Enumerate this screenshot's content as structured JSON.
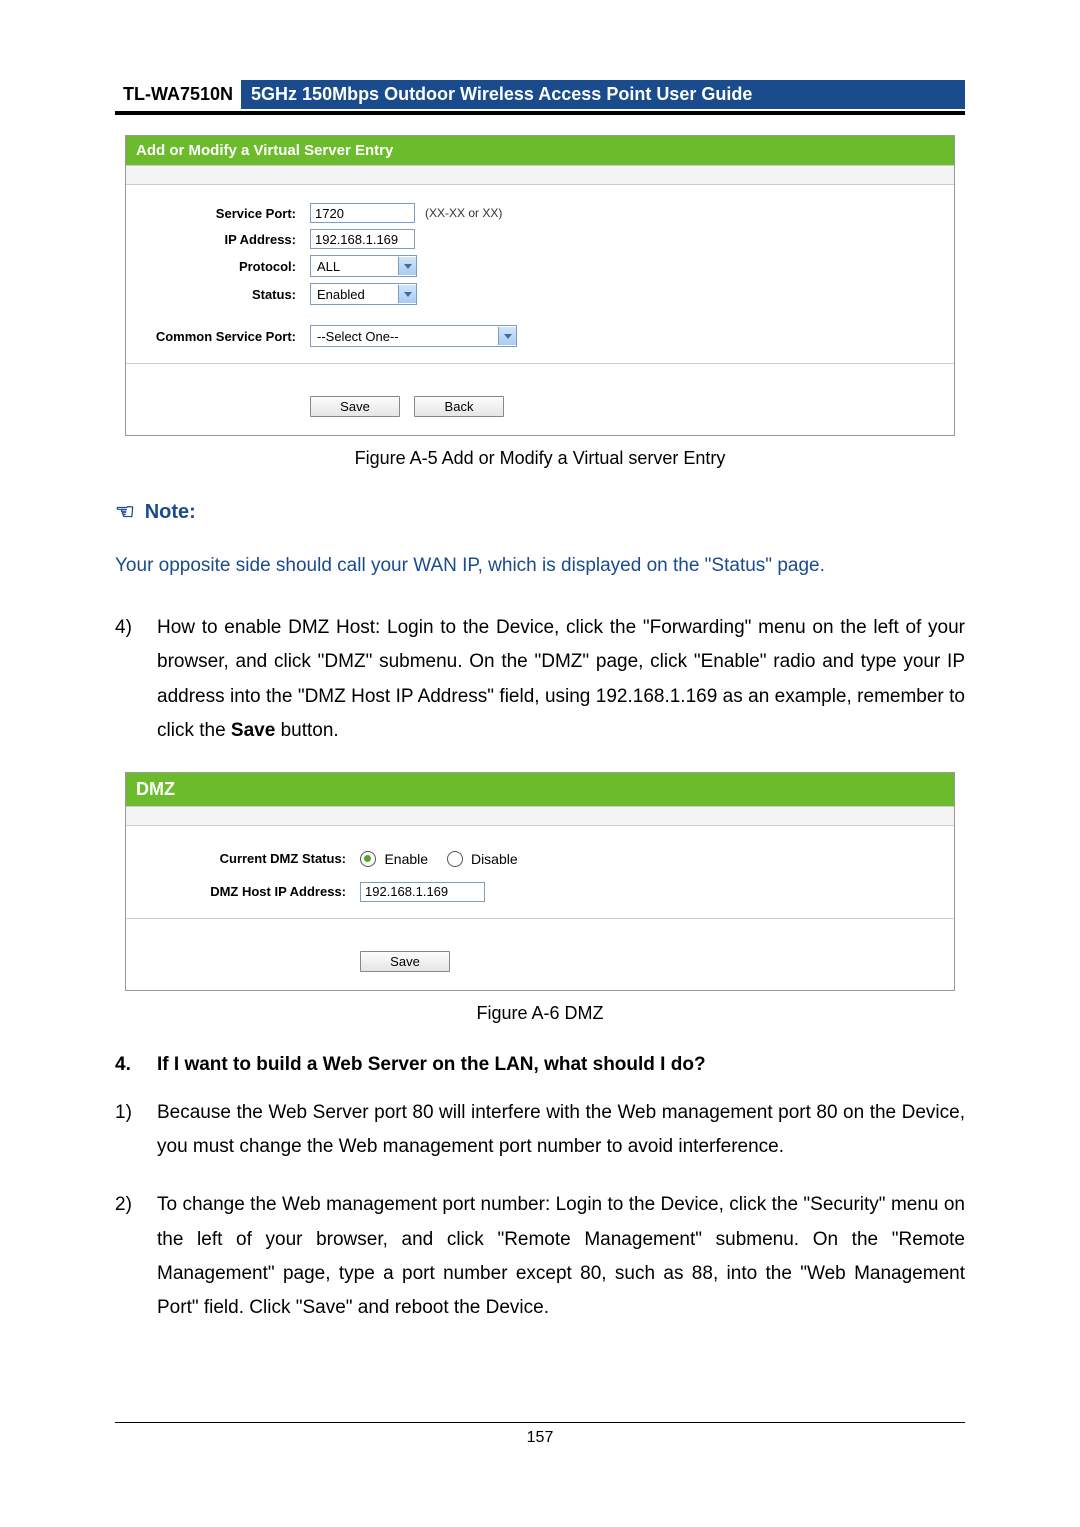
{
  "header": {
    "model": "TL-WA7510N",
    "title": "5GHz 150Mbps Outdoor Wireless Access Point User Guide"
  },
  "panel1": {
    "title": "Add or Modify a Virtual Server Entry",
    "rows": {
      "service_port_label": "Service Port:",
      "service_port_value": "1720",
      "service_port_hint": "(XX-XX or XX)",
      "ip_label": "IP Address:",
      "ip_value": "192.168.1.169",
      "protocol_label": "Protocol:",
      "protocol_value": "ALL",
      "status_label": "Status:",
      "status_value": "Enabled",
      "common_label": "Common Service Port:",
      "common_value": "--Select One--"
    },
    "buttons": {
      "save": "Save",
      "back": "Back"
    }
  },
  "caption1": "Figure A-5 Add or Modify a Virtual server Entry",
  "note_label": "Note:",
  "note_text": "Your opposite side should call your WAN IP, which is displayed on the \"Status\" page.",
  "step4_num": "4)",
  "step4_text_a": "How to enable DMZ Host: Login to the Device, click the \"Forwarding\" menu on the left of your browser, and click \"DMZ\" submenu. On the \"DMZ\" page, click \"Enable\" radio and type your IP address into the \"DMZ Host IP Address\" field, using 192.168.1.169 as an example, remember to click the ",
  "step4_save": "Save",
  "step4_text_b": " button.",
  "panel2": {
    "title": "DMZ",
    "status_label": "Current DMZ Status:",
    "enable_label": "Enable",
    "disable_label": "Disable",
    "ip_label": "DMZ Host IP Address:",
    "ip_value": "192.168.1.169",
    "save": "Save"
  },
  "caption2": "Figure A-6 DMZ",
  "q4_num": "4.",
  "q4_text": "If I want to build a Web Server on the LAN, what should I do?",
  "a1_num": "1)",
  "a1_text": "Because the Web Server port 80 will interfere with the Web management port 80 on the Device, you must change the Web management port number to avoid interference.",
  "a2_num": "2)",
  "a2_text": "To change the Web management port number: Login to the Device, click the \"Security\" menu on the left of your browser, and click \"Remote Management\" submenu. On the \"Remote Management\" page, type a port number except 80, such as 88, into the \"Web Management Port\" field. Click \"Save\" and reboot the Device.",
  "page_number": "157"
}
